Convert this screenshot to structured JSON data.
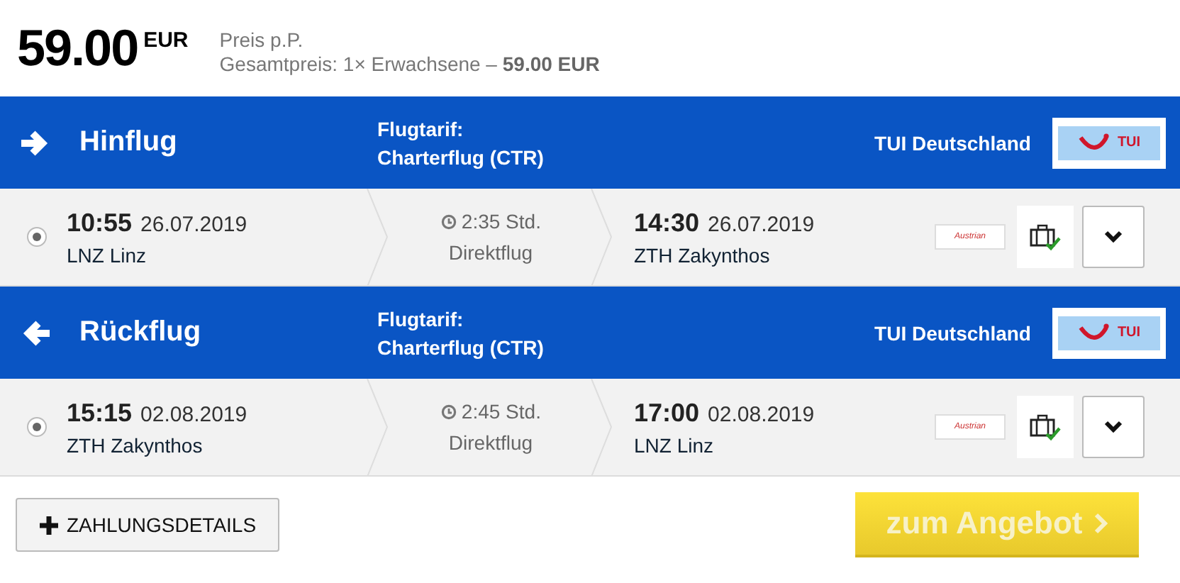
{
  "price": {
    "amount": "59.00",
    "currency": "EUR",
    "per_person": "Preis p.P.",
    "total_label": "Gesamtpreis: 1× Erwachsene –",
    "total_value": "59.00 EUR"
  },
  "legs": [
    {
      "kind": "outbound",
      "title": "Hinflug",
      "fare_label": "Flugtarif:",
      "fare": "Charterflug (CTR)",
      "operator": "TUI Deutschland",
      "operator_logo": "TUI",
      "selected": true,
      "dep_time": "10:55",
      "dep_date": "26.07.2019",
      "dep_airport": "LNZ Linz",
      "duration": "2:35 Std.",
      "stops": "Direktflug",
      "arr_time": "14:30",
      "arr_date": "26.07.2019",
      "arr_airport": "ZTH Zakynthos",
      "airline_logo": "Austrian",
      "luggage_included": true,
      "expanded": false
    },
    {
      "kind": "return",
      "title": "Rückflug",
      "fare_label": "Flugtarif:",
      "fare": "Charterflug (CTR)",
      "operator": "TUI Deutschland",
      "operator_logo": "TUI",
      "selected": true,
      "dep_time": "15:15",
      "dep_date": "02.08.2019",
      "dep_airport": "ZTH Zakynthos",
      "duration": "2:45 Std.",
      "stops": "Direktflug",
      "arr_time": "17:00",
      "arr_date": "02.08.2019",
      "arr_airport": "LNZ Linz",
      "airline_logo": "Austrian",
      "luggage_included": true,
      "expanded": false
    }
  ],
  "payment_button": "ZAHLUNGSDETAILS",
  "offer_button": "zum Angebot"
}
